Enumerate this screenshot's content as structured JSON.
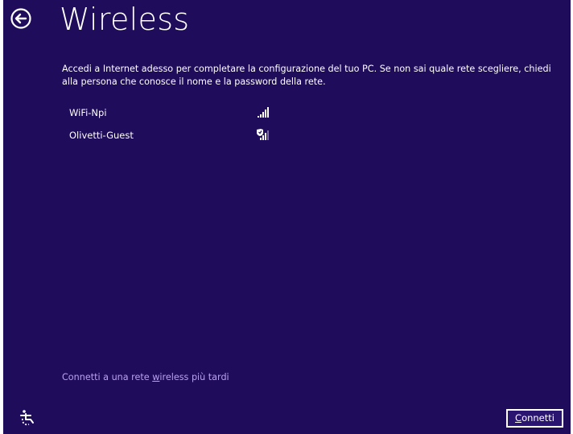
{
  "header": {
    "title": "Wireless",
    "back_icon": "back-arrow-icon"
  },
  "main": {
    "description": "Accedi a Internet adesso per completare la configurazione del tuo PC. Se non sai quale rete scegliere, chiedi alla persona che conosce il nome e la password della rete.",
    "networks": [
      {
        "name": "WiFi-Npi",
        "icon": "wifi-signal-icon",
        "secured": false,
        "signal_bars": 5
      },
      {
        "name": "Olivetti-Guest",
        "icon": "wifi-signal-shield-icon",
        "secured": true,
        "signal_bars": 3
      }
    ]
  },
  "footer": {
    "connect_later_prefix": "Connetti a una rete ",
    "connect_later_accel": "w",
    "connect_later_suffix": "ireless più tardi",
    "ease_of_access_icon": "ease-of-access-icon",
    "connect_button_accel": "C",
    "connect_button_rest": "onnetti"
  },
  "colors": {
    "background": "#1f0c5a",
    "link": "#b8a1f0",
    "text": "#ffffff"
  }
}
